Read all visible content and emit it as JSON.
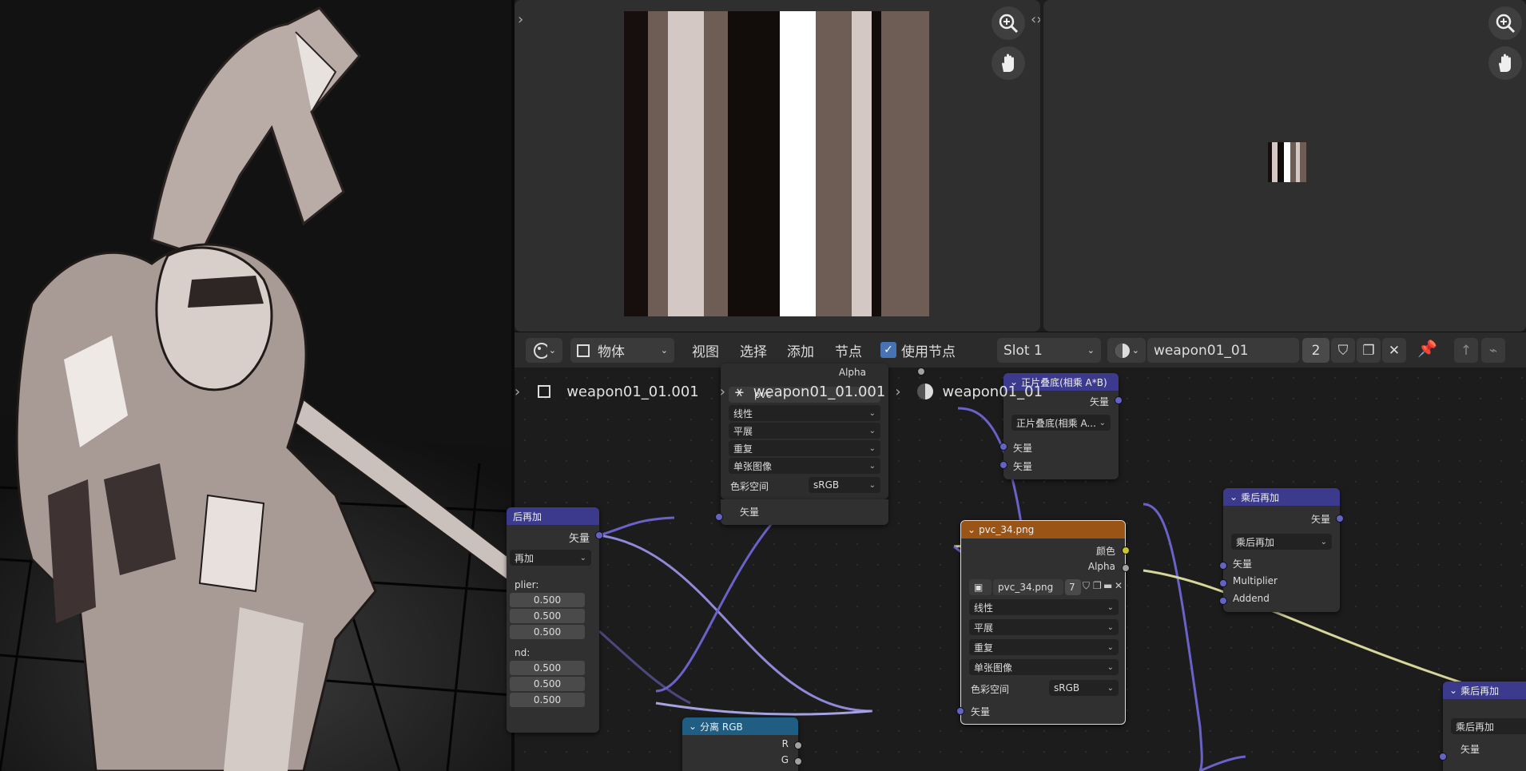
{
  "toolbar": {
    "mode": "物体",
    "menus": [
      "视图",
      "选择",
      "添加",
      "节点"
    ],
    "use_nodes_label": "使用节点",
    "slot": "Slot 1",
    "material": "weapon01_01",
    "user_count": "2"
  },
  "breadcrumb": {
    "object": "weapon01_01.001",
    "mesh": "weapon01_01.001",
    "material": "weapon01_01"
  },
  "nodes": {
    "left_partial": {
      "title": "后再加",
      "out_label": "矢量",
      "mode": "再加",
      "multiplier_label": "plier:",
      "multiplier_values": [
        "0.500",
        "0.500",
        "0.500"
      ],
      "addend_label": "nd:",
      "addend_values": [
        "0.500",
        "0.500",
        "0.500"
      ]
    },
    "img1": {
      "alpha": "Alpha",
      "image_name": "pvc",
      "interp": "线性",
      "projection": "平展",
      "extension": "重复",
      "source": "单张图像",
      "colorspace_label": "色彩空间",
      "colorspace": "sRGB",
      "vector": "矢量"
    },
    "multiply": {
      "title": "正片叠底(相乘 A*B)",
      "out_label": "矢量",
      "mode": "正片叠底(相乘 A...",
      "in1": "矢量",
      "in2": "矢量"
    },
    "pvc34": {
      "title": "pvc_34.png",
      "color": "颜色",
      "alpha": "Alpha",
      "image_name": "pvc_34.png",
      "users": "7",
      "interp": "线性",
      "projection": "平展",
      "extension": "重复",
      "source": "单张图像",
      "colorspace_label": "色彩空间",
      "colorspace": "sRGB",
      "vector": "矢量"
    },
    "muladd1": {
      "title": "乘后再加",
      "out_label": "矢量",
      "mode": "乘后再加",
      "in_vector": "矢量",
      "in_multiplier": "Multiplier",
      "in_addend": "Addend"
    },
    "muladd2": {
      "title": "乘后再加",
      "mode": "乘后再加",
      "in_vector": "矢量"
    },
    "separate": {
      "title": "分离 RGB",
      "r": "R",
      "g": "G"
    }
  },
  "colors": {
    "vector_socket": "#6363c7",
    "color_socket": "#c7c729",
    "float_socket": "#a1a1a1",
    "vector_header": "#3c3a8c",
    "texture_header": "#9a5516",
    "converter_header": "#1f5d82"
  }
}
